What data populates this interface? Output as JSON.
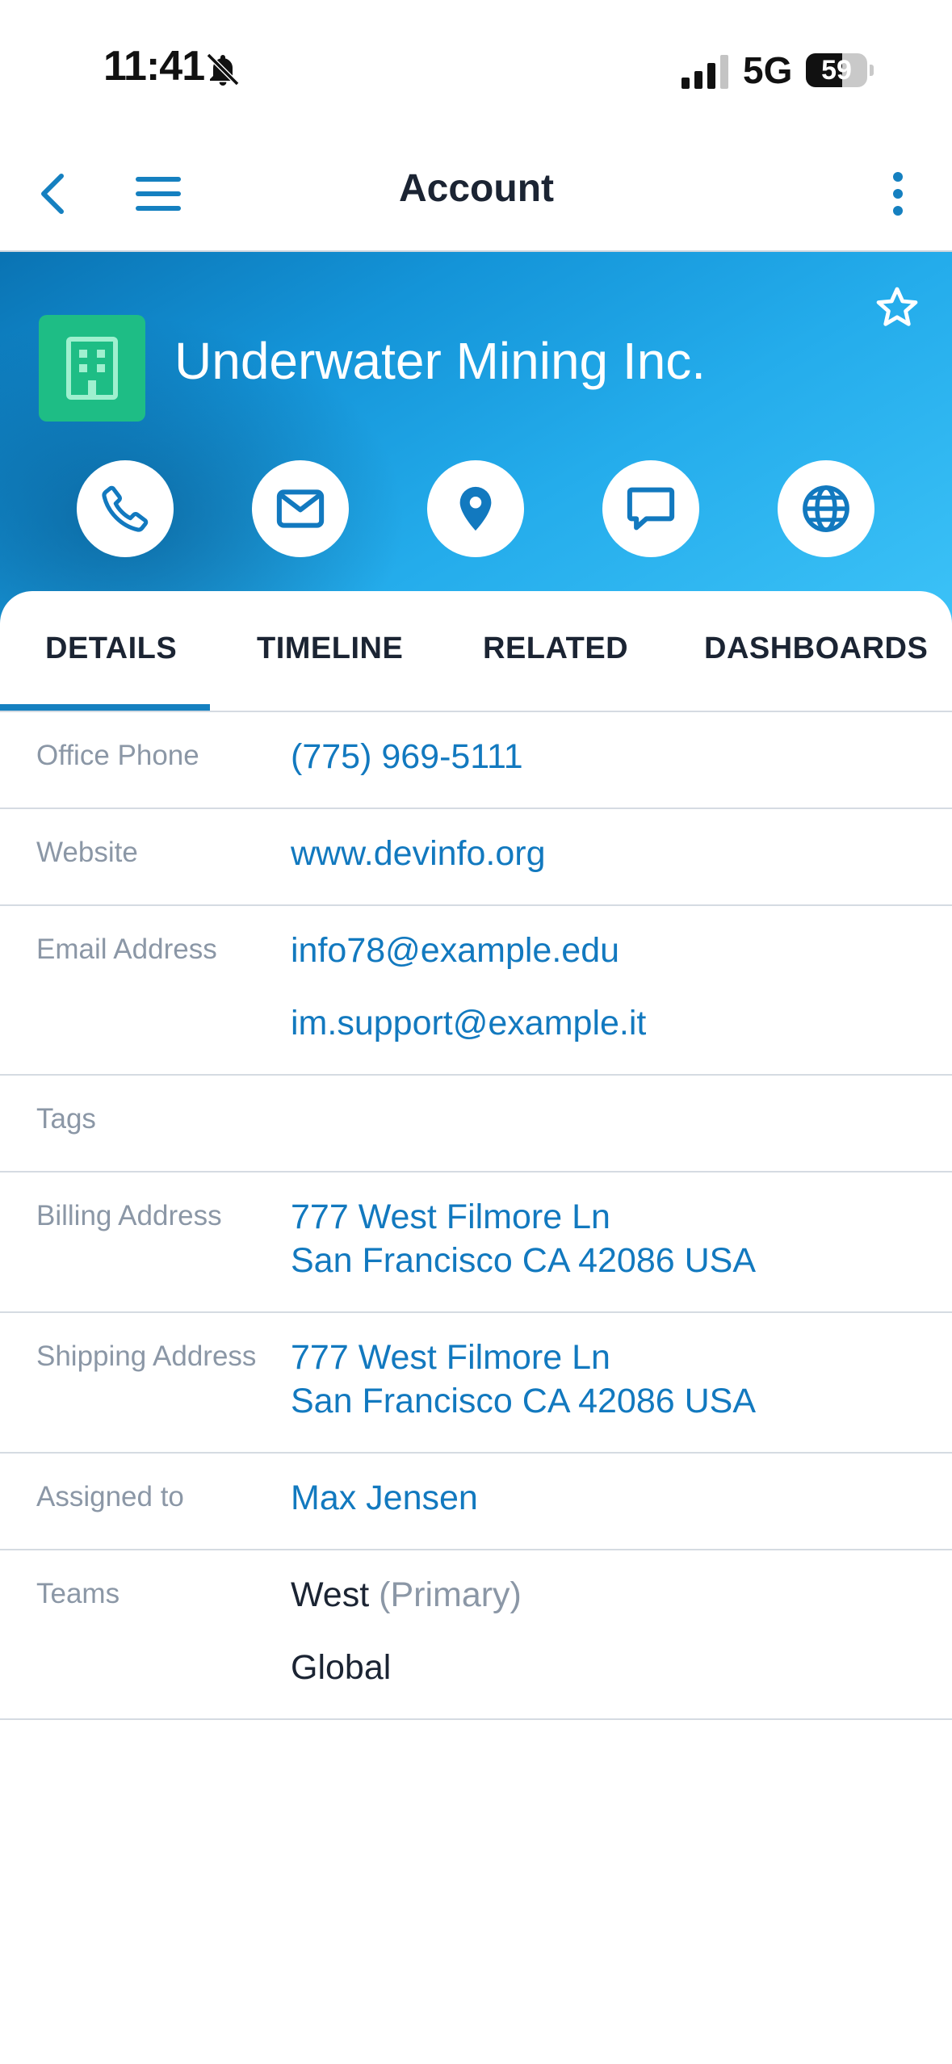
{
  "status_bar": {
    "time": "11:41",
    "network": "5G",
    "battery": "59",
    "battery_level": 0.59
  },
  "nav": {
    "title": "Account"
  },
  "account": {
    "name": "Underwater Mining Inc.",
    "avatar_color": "#1ebd85"
  },
  "actions": [
    {
      "icon": "phone-icon"
    },
    {
      "icon": "mail-icon"
    },
    {
      "icon": "map-pin-icon"
    },
    {
      "icon": "chat-icon"
    },
    {
      "icon": "globe-icon"
    }
  ],
  "tabs": [
    {
      "label": "DETAILS",
      "active": true
    },
    {
      "label": "TIMELINE",
      "active": false
    },
    {
      "label": "RELATED",
      "active": false
    },
    {
      "label": "DASHBOARDS",
      "active": false
    }
  ],
  "details": {
    "office_phone": {
      "label": "Office Phone",
      "value": "(775) 969-5111"
    },
    "website": {
      "label": "Website",
      "value": "www.devinfo.org"
    },
    "email": {
      "label": "Email Address",
      "values": [
        "info78@example.edu",
        "im.support@example.it"
      ]
    },
    "tags": {
      "label": "Tags",
      "value": ""
    },
    "billing_address": {
      "label": "Billing Address",
      "line1": "777 West Filmore Ln",
      "line2": "San Francisco CA 42086 USA"
    },
    "shipping_address": {
      "label": "Shipping Address",
      "line1": "777 West Filmore Ln",
      "line2": "San Francisco CA 42086 USA"
    },
    "assigned_to": {
      "label": "Assigned to",
      "value": "Max Jensen"
    },
    "teams": {
      "label": "Teams",
      "primary_team": "West",
      "primary_tag": "(Primary)",
      "other_team": "Global"
    }
  },
  "colors": {
    "accent": "#1279bf",
    "header_start": "#0a73b3",
    "header_end": "#3cc2f7",
    "label": "#8b97a6"
  }
}
